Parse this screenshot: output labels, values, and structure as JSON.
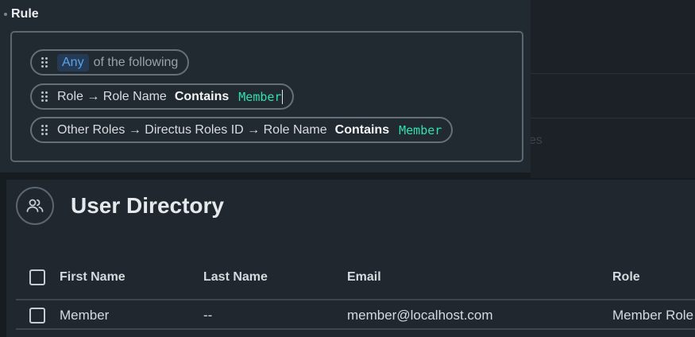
{
  "background": {
    "ghost_text": "es"
  },
  "rule": {
    "title": "Rule",
    "group": {
      "any_label": "Any",
      "suffix": "of the following"
    },
    "conditions": [
      {
        "field": "Role → Role Name",
        "operator": "Contains",
        "value": "Member"
      },
      {
        "field": "Other Roles → Directus Roles ID → Role Name",
        "operator": "Contains",
        "value": "Member"
      }
    ]
  },
  "directory": {
    "title": "User Directory",
    "icon": "users-icon",
    "columns": [
      "First Name",
      "Last Name",
      "Email",
      "Role"
    ],
    "rows": [
      {
        "first_name": "Member",
        "last_name": "--",
        "email": "member@localhost.com",
        "role": "Member Role"
      }
    ]
  },
  "colors": {
    "accent_blue": "#5aa3e8",
    "value_green": "#2fe0b0"
  }
}
